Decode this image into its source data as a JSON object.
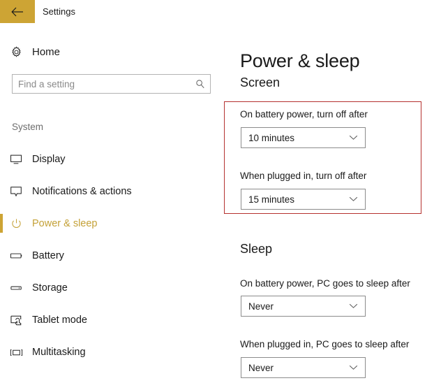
{
  "titlebar": {
    "back_label": "back-arrow",
    "title": "Settings"
  },
  "sidebar": {
    "home": {
      "label": "Home",
      "icon": "gear-icon"
    },
    "search": {
      "value": "",
      "placeholder": "Find a setting",
      "icon": "search-icon"
    },
    "group_label": "System",
    "items": [
      {
        "label": "Display",
        "icon": "monitor-icon",
        "selected": false
      },
      {
        "label": "Notifications & actions",
        "icon": "speech-bubble-icon",
        "selected": false
      },
      {
        "label": "Power & sleep",
        "icon": "power-icon",
        "selected": true
      },
      {
        "label": "Battery",
        "icon": "battery-icon",
        "selected": false
      },
      {
        "label": "Storage",
        "icon": "drive-icon",
        "selected": false
      },
      {
        "label": "Tablet mode",
        "icon": "tablet-touch-icon",
        "selected": false
      },
      {
        "label": "Multitasking",
        "icon": "multitask-icon",
        "selected": false
      }
    ]
  },
  "main": {
    "page_title": "Power & sleep",
    "screen": {
      "heading": "Screen",
      "battery_label": "On battery power, turn off after",
      "battery_value": "10 minutes",
      "plugged_label": "When plugged in, turn off after",
      "plugged_value": "15 minutes"
    },
    "sleep": {
      "heading": "Sleep",
      "battery_label": "On battery power, PC goes to sleep after",
      "battery_value": "Never",
      "plugged_label": "When plugged in, PC goes to sleep after",
      "plugged_value": "Never"
    }
  },
  "annotation": {
    "highlight_color": "#b5312f"
  },
  "colors": {
    "accent": "#cda434",
    "accent_text": "#c4a137",
    "text": "#1a1a1a",
    "muted_text": "#6e6e6e",
    "border": "#8c8c8c"
  }
}
